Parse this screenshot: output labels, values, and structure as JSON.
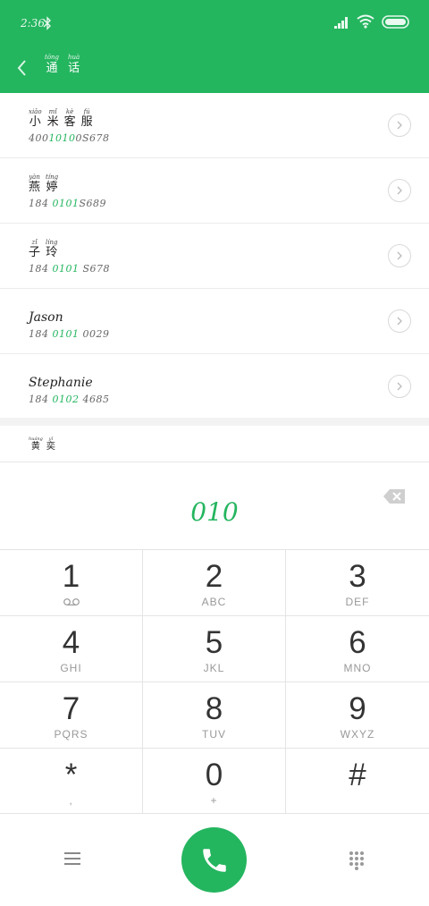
{
  "status_bar": {
    "time": "2:36",
    "icons": [
      "bluetooth-icon",
      "signal-icon",
      "wifi-icon",
      "battery-icon"
    ]
  },
  "header": {
    "back_icon": "chevron-left-icon",
    "title": [
      {
        "pinyin": "tōng",
        "hanzi": "通"
      },
      {
        "pinyin": "huà",
        "hanzi": "话"
      }
    ]
  },
  "contacts": [
    {
      "name_type": "hanzi",
      "name": [
        {
          "pinyin": "xiǎo",
          "hanzi": "小"
        },
        {
          "pinyin": "mǐ",
          "hanzi": "米"
        },
        {
          "pinyin": "kè",
          "hanzi": "客"
        },
        {
          "pinyin": "fú",
          "hanzi": "服"
        }
      ],
      "number_pre": "400",
      "number_hl": "1010",
      "number_post": "0S678"
    },
    {
      "name_type": "hanzi",
      "name": [
        {
          "pinyin": "yàn",
          "hanzi": "燕"
        },
        {
          "pinyin": "tíng",
          "hanzi": "婷"
        }
      ],
      "number_pre": "184 ",
      "number_hl": "0101",
      "number_post": "S689"
    },
    {
      "name_type": "hanzi",
      "name": [
        {
          "pinyin": "zǐ",
          "hanzi": "子"
        },
        {
          "pinyin": "líng",
          "hanzi": "玲"
        }
      ],
      "number_pre": "184 ",
      "number_hl": "0101",
      "number_post": " S678"
    },
    {
      "name_type": "latin",
      "name_text": "Jason",
      "number_pre": "184 ",
      "number_hl": "0101",
      "number_post": " 0029"
    },
    {
      "name_type": "latin",
      "name_text": "Stephanie",
      "number_pre": "184 ",
      "number_hl": "0102",
      "number_post": " 4685"
    }
  ],
  "partial_contact": {
    "name": [
      {
        "pinyin": "huáng",
        "hanzi": "黄"
      },
      {
        "pinyin": "yī",
        "hanzi": "奕"
      }
    ]
  },
  "dial": {
    "value": "010",
    "backspace_icon": "backspace-icon"
  },
  "keypad": [
    {
      "digit": "1",
      "letters": "",
      "sub_icon": "voicemail-icon"
    },
    {
      "digit": "2",
      "letters": "ABC"
    },
    {
      "digit": "3",
      "letters": "DEF"
    },
    {
      "digit": "4",
      "letters": "GHI"
    },
    {
      "digit": "5",
      "letters": "JKL"
    },
    {
      "digit": "6",
      "letters": "MNO"
    },
    {
      "digit": "7",
      "letters": "PQRS"
    },
    {
      "digit": "8",
      "letters": "TUV"
    },
    {
      "digit": "9",
      "letters": "WXYZ"
    },
    {
      "digit": "*",
      "letters": ","
    },
    {
      "digit": "0",
      "letters": "+"
    },
    {
      "digit": "#",
      "letters": ""
    }
  ],
  "bottom_bar": {
    "left_icon": "menu-icon",
    "center_icon": "phone-icon",
    "right_icon": "dialpad-icon"
  },
  "colors": {
    "accent": "#24b55f",
    "header_bg": "#24b55f",
    "divider": "#e4e4e4",
    "key_text": "#333333",
    "key_sub_text": "#999999"
  }
}
